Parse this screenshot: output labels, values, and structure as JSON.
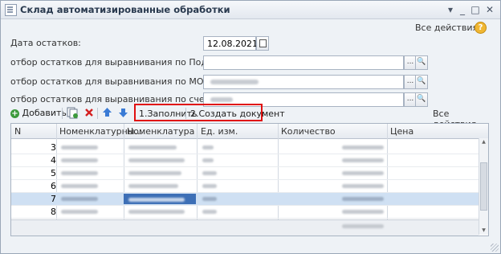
{
  "window": {
    "title": "Склад автоматизированные обработки",
    "controls": [
      "▾",
      "_",
      "□",
      "✕"
    ]
  },
  "all_actions_top": "Все действия",
  "help_label": "?",
  "form": {
    "date_label": "Дата остатков:",
    "date_value": "12.08.2021",
    "dept_label": "отбор остатков для выравнивания по Подразделению:",
    "mol_label": "отбор остатков для выравнивания по МОЛу:",
    "account_label": "отбор остатков для выравнивания по счету:",
    "select_btn": "...",
    "open_btn": "🔍"
  },
  "toolbar": {
    "add_label": "Добавить",
    "fill_label": "1.Заполнить",
    "create_doc_label": "2.Создать документ",
    "all_actions_label": "Все действия",
    "arrow_down": "▾"
  },
  "table": {
    "columns": [
      "N",
      "Номенклатурны...",
      "Номенклатура",
      "Ед. изм.",
      "Количество",
      "Цена"
    ],
    "rows": [
      {
        "n": "3"
      },
      {
        "n": "4"
      },
      {
        "n": "5"
      },
      {
        "n": "6"
      },
      {
        "n": "7"
      },
      {
        "n": "8"
      }
    ],
    "selected_row_number": "7"
  },
  "colors": {
    "highlight_box": "#e01010",
    "selected_row": "#cfe0f3",
    "selected_cell": "#3d6fb6",
    "add_icon": "#3c9a3c",
    "delete_icon": "#d42020",
    "arrow_icons": "#3a7bd5"
  }
}
